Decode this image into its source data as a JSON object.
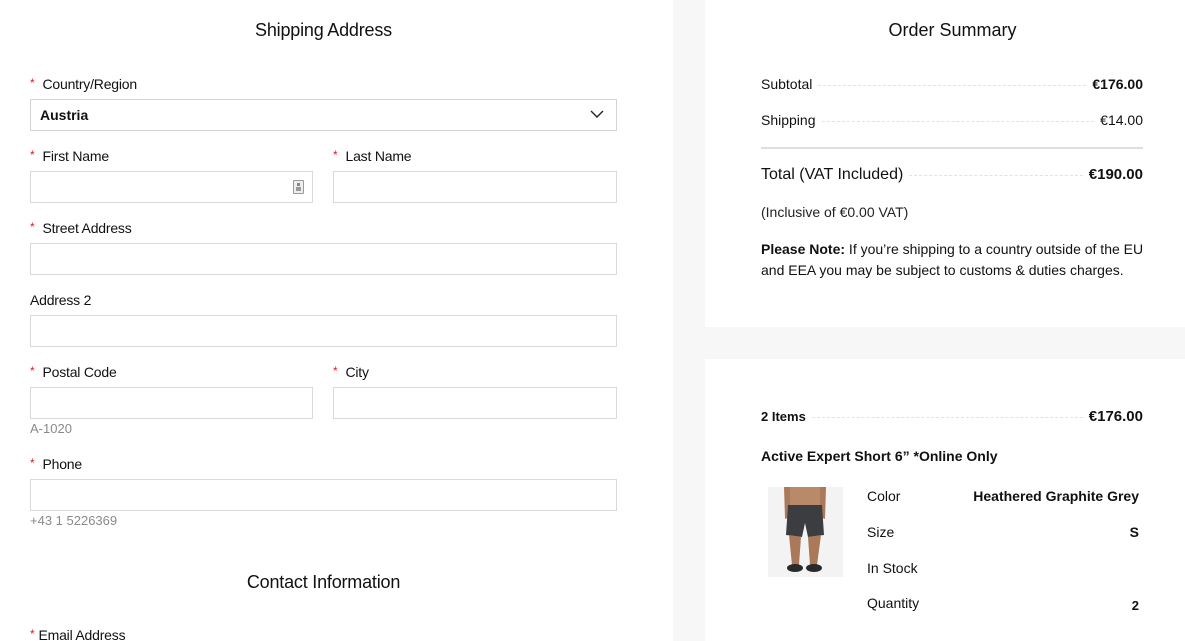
{
  "shipping": {
    "title": "Shipping Address",
    "required_marker": "*",
    "country": {
      "label": "Country/Region",
      "value": "Austria"
    },
    "first_name": {
      "label": "First Name",
      "value": ""
    },
    "last_name": {
      "label": "Last Name",
      "value": ""
    },
    "street": {
      "label": "Street Address",
      "value": ""
    },
    "address2": {
      "label": "Address 2",
      "value": ""
    },
    "postal_code": {
      "label": "Postal Code",
      "value": "",
      "hint": "A-1020"
    },
    "city": {
      "label": "City",
      "value": ""
    },
    "phone": {
      "label": "Phone",
      "value": "",
      "hint": "+43 1 5226369"
    }
  },
  "contact": {
    "title": "Contact Information",
    "email": {
      "label": "Email Address"
    }
  },
  "order_summary": {
    "title": "Order Summary",
    "subtotal_label": "Subtotal",
    "subtotal_value": "€176.00",
    "shipping_label": "Shipping",
    "shipping_value": "€14.00",
    "total_label": "Total (VAT Included)",
    "total_value": "€190.00",
    "vat_note": "(Inclusive of €0.00 VAT)",
    "please_note_bold": "Please Note:",
    "please_note_text": " If you’re shipping to a country outside of the EU and EEA you may be subject to customs & duties charges."
  },
  "items": {
    "count_label": "2 Items",
    "count_value": "€176.00",
    "product": {
      "name": "Active Expert Short 6” *Online Only",
      "image_alt": "Active Expert Short product photo",
      "attributes": [
        {
          "label": "Color",
          "value": "Heathered Graphite Grey"
        },
        {
          "label": "Size",
          "value": "S"
        },
        {
          "label": "In Stock",
          "value": ""
        },
        {
          "label": "Quantity",
          "value": "2"
        }
      ]
    }
  },
  "colors": {
    "required": "#d22030",
    "hint": "#8a8a8a",
    "border": "#d9d9d9",
    "page_bg": "#f7f7f7"
  }
}
